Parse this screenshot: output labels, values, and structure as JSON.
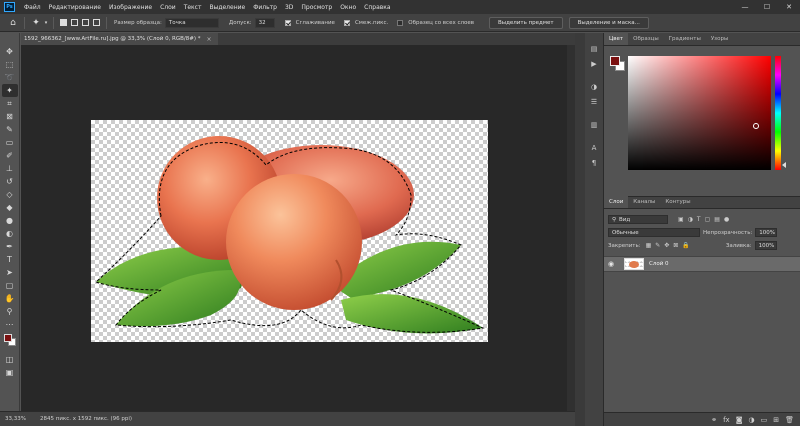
{
  "menubar": {
    "logo": "Ps",
    "items": [
      "Файл",
      "Редактирование",
      "Изображение",
      "Слои",
      "Текст",
      "Выделение",
      "Фильтр",
      "3D",
      "Просмотр",
      "Окно",
      "Справка"
    ]
  },
  "options": {
    "sample_size_label": "Размер образца:",
    "sample_size_value": "Точка",
    "tolerance_label": "Допуск:",
    "tolerance_value": "32",
    "antialias_label": "Сглаживание",
    "antialias_checked": true,
    "contiguous_label": "Смеж.пикс.",
    "contiguous_checked": true,
    "sample_all_label": "Образец со всех слоев",
    "sample_all_checked": false,
    "select_subject_label": "Выделить предмет",
    "select_mask_label": "Выделение и маска..."
  },
  "document": {
    "tab_title": "1592_966362_[www.ArtFile.ru].jpg @ 33,3% (Слой 0, RGB/8#) *",
    "close": "×"
  },
  "status": {
    "zoom": "33,33%",
    "info": "2845 пикс. x 1592 пикс. (96 ppi)"
  },
  "color_panel": {
    "tabs": [
      "Цвет",
      "Образцы",
      "Градиенты",
      "Узоры"
    ],
    "foreground": "#7a1010",
    "background": "#ffffff"
  },
  "layers_panel": {
    "tabs": [
      "Слои",
      "Каналы",
      "Контуры"
    ],
    "filter_kind": "Вид",
    "blend_mode": "Обычные",
    "opacity_label": "Непрозрачность:",
    "opacity_value": "100%",
    "lock_label": "Закрепить:",
    "fill_label": "Заливка:",
    "fill_value": "100%",
    "layers": [
      {
        "name": "Слой 0",
        "visible": true
      }
    ]
  },
  "icons": {
    "home": "⌂",
    "wand": "✦",
    "eye": "👁",
    "min": "—",
    "max": "☐",
    "close": "✕"
  }
}
